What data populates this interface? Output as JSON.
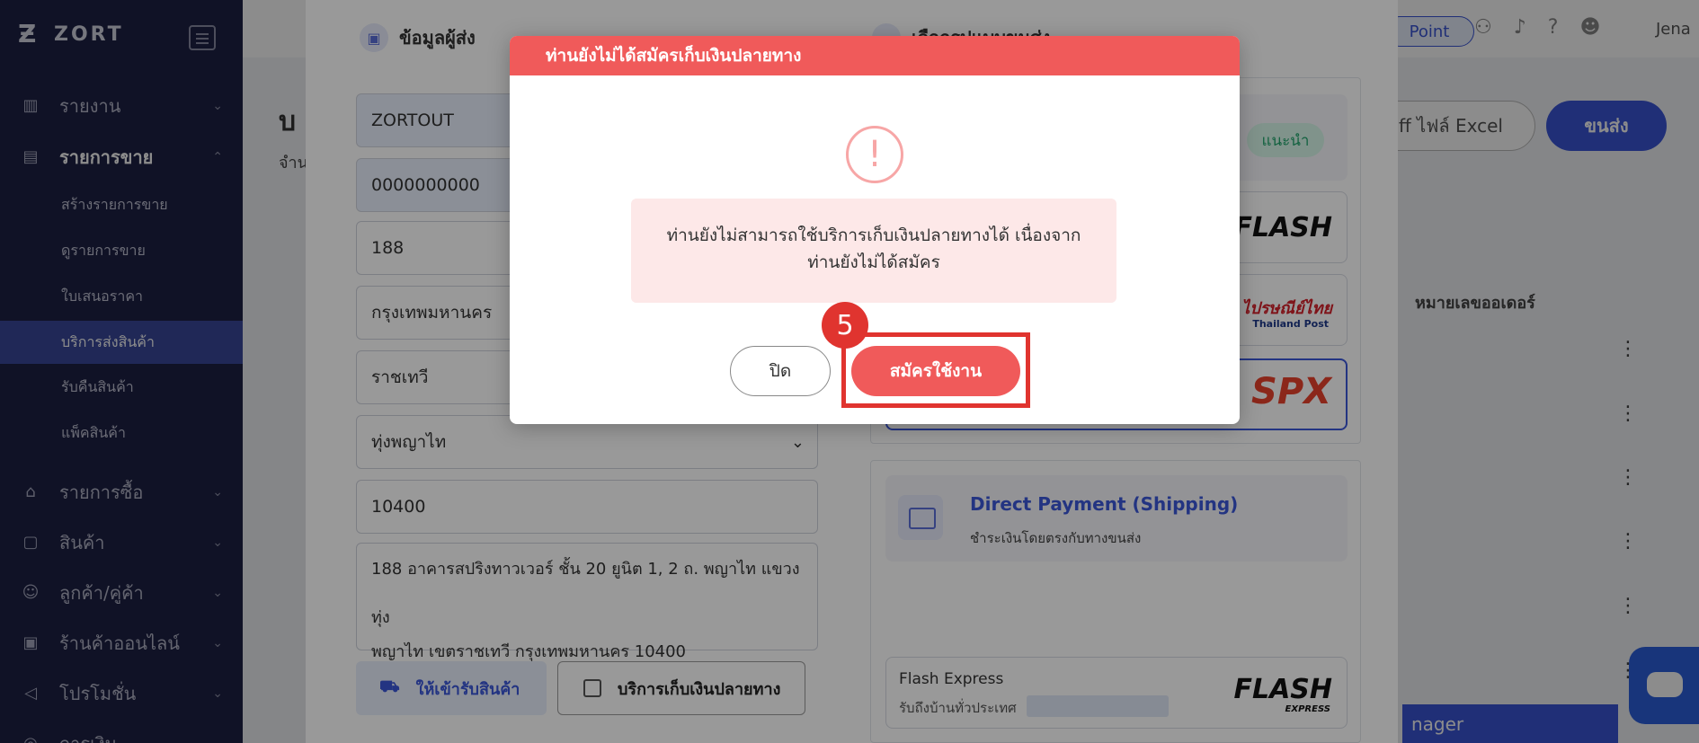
{
  "app": {
    "brand": "ZORT"
  },
  "sidebar": {
    "items": [
      {
        "label": "รายงาน",
        "icon": "bar-chart-icon"
      },
      {
        "label": "รายการขาย",
        "icon": "clipboard-icon"
      },
      {
        "label": "รายการซื้อ",
        "icon": "basket-icon"
      },
      {
        "label": "สินค้า",
        "icon": "box-icon"
      },
      {
        "label": "ลูกค้า/คู่ค้า",
        "icon": "users-icon"
      },
      {
        "label": "ร้านค้าออนไลน์",
        "icon": "store-icon"
      },
      {
        "label": "โปรโมชั่น",
        "icon": "megaphone-icon"
      },
      {
        "label": "การเงิน",
        "icon": "wallet-icon"
      }
    ],
    "sub_items": [
      "สร้างรายการขาย",
      "ดูรายการขาย",
      "ใบเสนอราคา",
      "บริการส่งสินค้า",
      "รับคืนสินค้า",
      "แพ็คสินค้า"
    ]
  },
  "header": {
    "point_label": "Point",
    "user_name": "Jena",
    "excel_button": "ff ไฟล์ Excel",
    "ship_button": "ขนส่ง",
    "page_title_partial": "บ",
    "page_sub_partial": "จำน",
    "column_header": "หมายเลขออเดอร์",
    "manager_label": "nager"
  },
  "sender": {
    "title": "ข้อมูลผู้ส่ง",
    "fields": [
      "ZORTOUT",
      "0000000000",
      "188",
      "กรุงเทพมหานคร",
      "ราชเทวี",
      "ทุ่งพญาไท",
      "10400"
    ],
    "address_line1": "188 อาคารสปริงทาวเวอร์ ชั้น 20 ยูนิต 1, 2 ถ. พญาไท แขวงทุ่ง",
    "address_line2": "พญาไท เขตราชเทวี กรุงเทพมหานคร 10400",
    "pickup_button": "ให้เข้ารับสินค้า",
    "cod_label": "บริการเก็บเงินปลายทาง"
  },
  "shipping": {
    "title": "เลือกรูปแบบขนส่ง",
    "recommended_badge": "แนะนำ",
    "carriers": [
      "FLASH",
      "ไปรษณีย์ไทย",
      "SPX"
    ],
    "thailand_post_sub": "Thailand Post",
    "express_text": "EXPRESS",
    "payment_title": "Direct Payment (Shipping)",
    "payment_sub": "ชำระเงินโดยตรงกับทางขนส่ง",
    "flash_name": "Flash Express",
    "flash_sub": "รับถึงบ้านทั่วประเทศ"
  },
  "modal": {
    "title": "ท่านยังไม่ได้สมัครเก็บเงินปลายทาง",
    "message_line1": "ท่านยังไม่สามารถใช้บริการเก็บเงินปลายทางได้ เนื่องจาก",
    "message_line2": "ท่านยังไม่ได้สมัคร",
    "close_button": "ปิด",
    "signup_button": "สมัครใช้งาน",
    "icon": "warning-icon"
  },
  "annotation": {
    "step_number": "5"
  },
  "colors": {
    "accent": "#3b57d9",
    "danger": "#f05a5a",
    "sidebar": "#1e2145"
  }
}
